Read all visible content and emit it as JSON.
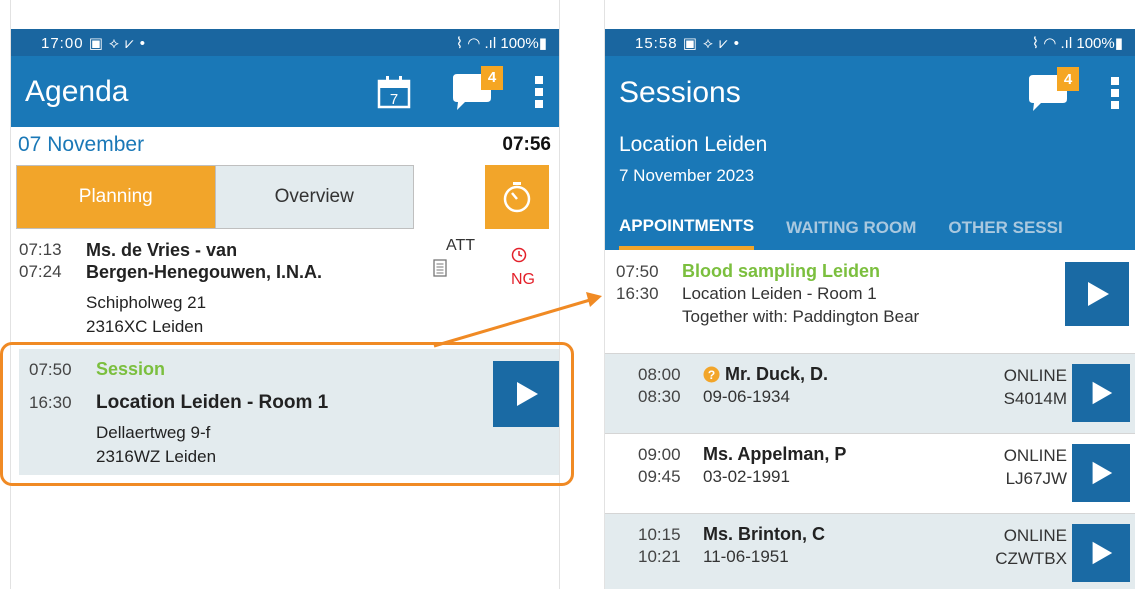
{
  "left": {
    "status_time": "17:00",
    "status_battery": "100%",
    "title": "Agenda",
    "calendar_day": "7",
    "chat_badge": "4",
    "date": "07 November",
    "clock": "07:56",
    "tab_planning": "Planning",
    "tab_overview": "Overview",
    "appointment": {
      "start": "07:13",
      "end": "07:24",
      "name_line1": "Ms. de Vries - van",
      "name_line2": "Bergen-Henegouwen, I.N.A.",
      "addr1": "Schipholweg 21",
      "addr2": "2316XC Leiden",
      "type": "ATT",
      "status": "NG"
    },
    "session": {
      "start": "07:50",
      "end": "16:30",
      "label": "Session",
      "location": "Location Leiden - Room 1",
      "addr1": "Dellaertweg 9-f",
      "addr2": "2316WZ Leiden"
    }
  },
  "right": {
    "status_time": "15:58",
    "status_battery": "100%",
    "title": "Sessions",
    "chat_badge": "4",
    "location": "Location Leiden",
    "date": "7 November 2023",
    "tabs": [
      "APPOINTMENTS",
      "WAITING ROOM",
      "OTHER SESSI"
    ],
    "session": {
      "start": "07:50",
      "end": "16:30",
      "title": "Blood sampling Leiden",
      "location": "Location Leiden - Room 1",
      "together": "Together with: Paddington Bear"
    },
    "patients": [
      {
        "start": "08:00",
        "end": "08:30",
        "name": "Mr. Duck, D.",
        "dob": "09-06-1934",
        "mode": "ONLINE",
        "code": "S4014M"
      },
      {
        "start": "09:00",
        "end": "09:45",
        "name": "Ms. Appelman, P",
        "dob": "03-02-1991",
        "mode": "ONLINE",
        "code": "LJ67JW"
      },
      {
        "start": "10:15",
        "end": "10:21",
        "name": "Ms. Brinton, C",
        "dob": "11-06-1951",
        "mode": "ONLINE",
        "code": "CZWTBX"
      }
    ]
  },
  "colors": {
    "appbar": "#1a78b7",
    "accent_orange": "#f2a52a",
    "green": "#7bbf3e",
    "card_bg": "#e3ebee",
    "play_btn": "#1a6aa4",
    "red": "#e3202a"
  }
}
